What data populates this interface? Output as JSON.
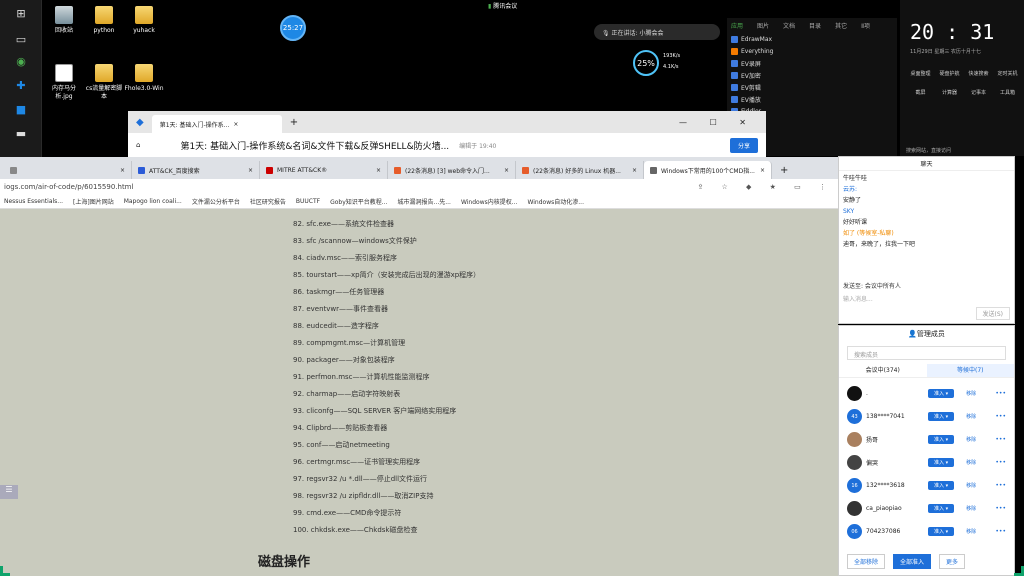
{
  "desktop": {
    "icons": [
      {
        "label": "回收站",
        "kind": "bin"
      },
      {
        "label": "python",
        "kind": "folder"
      },
      {
        "label": "yuhack",
        "kind": "folder"
      },
      {
        "label": "内存马分析.jpg",
        "kind": "image"
      },
      {
        "label": "cs流量解密脚本",
        "kind": "folder"
      },
      {
        "label": "Fhole3.0-Win",
        "kind": "folder"
      }
    ],
    "circle_badge": "25:27",
    "meeting_label": "腾讯会议",
    "voice_hint": "正在讲话: 小腾会会",
    "net_widget": {
      "percent": "25%",
      "up": "193K/s",
      "down": "4.1K/s"
    }
  },
  "app_panel": {
    "tabs": [
      "应用",
      "图片",
      "文档",
      "目录",
      "其它",
      "Ⅱ项"
    ],
    "items": [
      "EdrawMax",
      "Everything",
      "EV录屏",
      "EV加密",
      "EV剪辑",
      "EV播放",
      "Fiddler"
    ]
  },
  "clock_widget": {
    "time": "20 : 31",
    "date": "11月29日   星期三   农历十月十七",
    "actions": [
      "桌面整理",
      "硬盘护航",
      "快速搜索",
      "定时关机",
      "截屏",
      "计算器",
      "记事本",
      "工具箱"
    ],
    "search": "搜索网站，直接访问"
  },
  "browser_top": {
    "tab_title": "第1天: 基础入门-操作系...",
    "page_title": "第1天: 基础入门-操作系统&名词&文件下载&反弹SHELL&防火墙...",
    "share": "分享",
    "edit_time": "编辑于 19:40"
  },
  "browser_main": {
    "tabs": [
      {
        "title": "",
        "color": "#888",
        "active": false
      },
      {
        "title": "ATT&CK_百度搜索",
        "color": "#2b5bd7",
        "active": false
      },
      {
        "title": "MITRE ATT&CK®",
        "color": "#c00",
        "active": false
      },
      {
        "title": "(22条消息) [3] web命令入门...",
        "color": "#e65c2a",
        "active": false
      },
      {
        "title": "(22条消息) 好多的 Linux 机器...",
        "color": "#e65c2a",
        "active": false
      },
      {
        "title": "Windows下常用的100个CMD指...",
        "color": "#666",
        "active": true
      }
    ],
    "url": "iogs.com/air-of-code/p/6015590.html",
    "bookmarks": [
      "Nessus Essentials...",
      "[上海]图片网站",
      "Mapogo lion coali...",
      "文件漏公分析平台",
      "社区研究报告",
      "BUUCTF",
      "Goby知识平台教程...",
      "城市漏洞报告...先...",
      "Windows内核提权...",
      "Windows自动化渗..."
    ]
  },
  "commands": [
    "82. sfc.exe——系统文件检查器",
    "83. sfc /scannow—windows文件保护",
    "84. ciadv.msc——索引服务程序",
    "85. tourstart——xp简介（安装完成后出现的漫游xp程序）",
    "86. taskmgr——任务管理器",
    "87. eventvwr——事件查看器",
    "88. eudcedit——造字程序",
    "89. compmgmt.msc—计算机管理",
    "90. packager——对象包装程序",
    "91. perfmon.msc——计算机性能监测程序",
    "92. charmap——启动字符映射表",
    "93. cliconfg——SQL SERVER 客户端网络实用程序",
    "94. Clipbrd——剪贴板查看器",
    "95. conf——启动netmeeting",
    "96. certmgr.msc——证书管理实用程序",
    "97. regsvr32 /u *.dll——停止dll文件运行",
    "98. regsvr32 /u zipfldr.dll——取消ZIP支持",
    "99. cmd.exe——CMD命令提示符",
    "100. chkdsk.exe——Chkdsk磁盘检查"
  ],
  "section_heading": "磁盘操作",
  "chat": {
    "title": "聊天",
    "messages": [
      {
        "text": "牛哇牛哇",
        "style": ""
      },
      {
        "text": "云苏:",
        "style": "blue"
      },
      {
        "text": "安静了",
        "style": ""
      },
      {
        "text": "SKY",
        "style": "blue"
      },
      {
        "text": "好好听课",
        "style": ""
      },
      {
        "text": "如了 (等候室-私聊)",
        "style": "orange"
      },
      {
        "text": "迪哥，来晚了，拉我一下吧",
        "style": ""
      }
    ],
    "send_to": "发送至: 会议中所有人",
    "input_placeholder": "输入消息...",
    "send": "发送(S)"
  },
  "members": {
    "title": "管理成员",
    "search_placeholder": "搜索成员",
    "tab_in_meeting": "会议中(374)",
    "tab_waiting": "等候中(7)",
    "admit": "准入",
    "remove": "移除",
    "list": [
      {
        "name": ".",
        "avatar": "",
        "color": "#111"
      },
      {
        "name": "138****7041",
        "avatar": "43",
        "color": "#1e6fd9"
      },
      {
        "name": "扬哥",
        "avatar": "",
        "color": "#a9805f"
      },
      {
        "name": "偏哭",
        "avatar": "",
        "color": "#444"
      },
      {
        "name": "132****3618",
        "avatar": "16",
        "color": "#1e6fd9"
      },
      {
        "name": "ca_piaopiao",
        "avatar": "",
        "color": "#333"
      },
      {
        "name": "704237086",
        "avatar": "06",
        "color": "#1e6fd9"
      }
    ],
    "footer": [
      "全部移除",
      "全部准入",
      "更多"
    ]
  }
}
